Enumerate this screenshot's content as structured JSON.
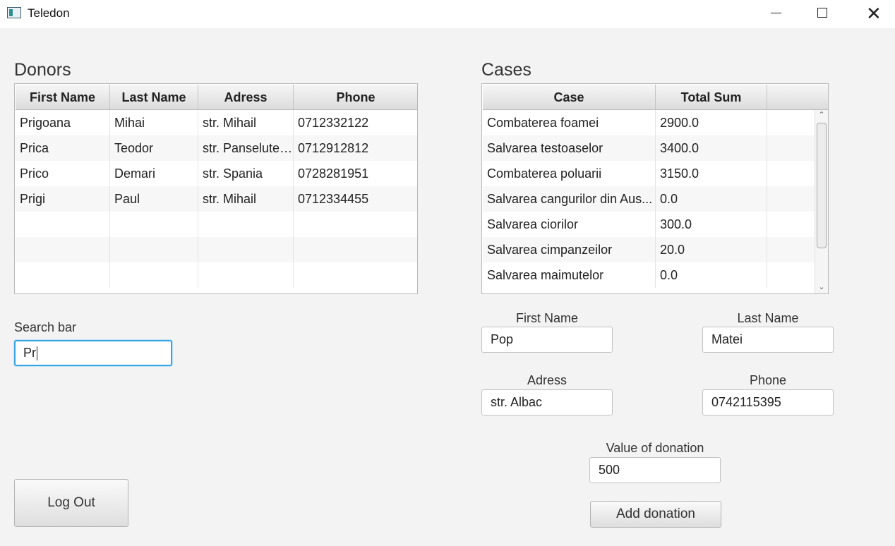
{
  "window": {
    "title": "Teledon"
  },
  "donors": {
    "title": "Donors",
    "columns": [
      "First Name",
      "Last Name",
      "Adress",
      "Phone"
    ],
    "rows": [
      [
        "Prigoana",
        "Mihai",
        "str. Mihail",
        "0712332122"
      ],
      [
        "Prica",
        "Teodor",
        "str. Panselutel...",
        "0712912812"
      ],
      [
        "Prico",
        "Demari",
        "str. Spania",
        "0728281951"
      ],
      [
        "Prigi",
        "Paul",
        "str. Mihail",
        "0712334455"
      ]
    ]
  },
  "cases": {
    "title": "Cases",
    "columns": [
      "Case",
      "Total Sum",
      ""
    ],
    "rows": [
      [
        "Combaterea foamei",
        "2900.0"
      ],
      [
        "Salvarea testoaselor",
        "3400.0"
      ],
      [
        "Combaterea poluarii",
        "3150.0"
      ],
      [
        "Salvarea cangurilor din Aus...",
        "0.0"
      ],
      [
        "Salvarea ciorilor",
        "300.0"
      ],
      [
        "Salvarea cimpanzeilor",
        "20.0"
      ],
      [
        "Salvarea maimutelor",
        "0.0"
      ]
    ]
  },
  "search": {
    "label": "Search bar",
    "value": "Pr"
  },
  "form": {
    "first_name": {
      "label": "First Name",
      "value": "Pop"
    },
    "last_name": {
      "label": "Last Name",
      "value": "Matei"
    },
    "address": {
      "label": "Adress",
      "value": "str. Albac"
    },
    "phone": {
      "label": "Phone",
      "value": "0742115395"
    },
    "donation": {
      "label": "Value of donation",
      "value": "500"
    },
    "add_button": "Add donation"
  },
  "logout_button": "Log Out",
  "icons": {
    "app": "app-window-icon",
    "minimize": "minimize-icon",
    "maximize": "maximize-icon",
    "close": "close-icon"
  },
  "colors": {
    "focus": "#3aa3e3",
    "background": "#f3f3f3"
  }
}
